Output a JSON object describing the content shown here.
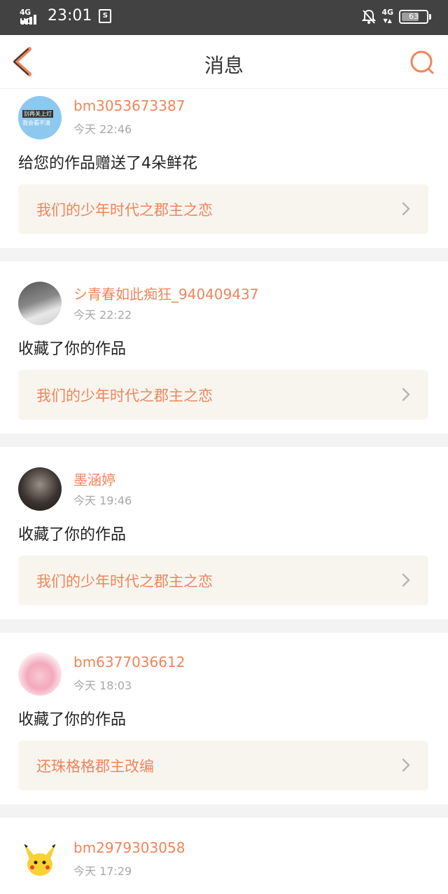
{
  "status_bar": {
    "network": "4G HD",
    "time": "23:01",
    "sim_icon": "sim-icon",
    "mobile_type": "4G",
    "battery": "63"
  },
  "header": {
    "title": "消息",
    "back_icon": "back-arrow-icon",
    "search_icon": "search-icon"
  },
  "messages": [
    {
      "username": "bm3053673387",
      "time": "今天 22:46",
      "action": "给您的作品赠送了4朵鲜花",
      "work_title": "我们的少年时代之郡主之恋",
      "avatar_line1": "别再关上灯",
      "avatar_line2": "我会看不清"
    },
    {
      "username": "シ青春如此痴狂_940409437",
      "time": "今天 22:22",
      "action": "收藏了你的作品",
      "work_title": "我们的少年时代之郡主之恋"
    },
    {
      "username": "墨涵婷",
      "time": "今天 19:46",
      "action": "收藏了你的作品",
      "work_title": "我们的少年时代之郡主之恋"
    },
    {
      "username": "bm6377036612",
      "time": "今天 18:03",
      "action": "收藏了你的作品",
      "work_title": "还珠格格郡主改编"
    },
    {
      "username": "bm2979303058",
      "time": "今天 17:29"
    }
  ],
  "colors": {
    "accent": "#f0855a",
    "status_bar": "#424242",
    "card_bg": "#f8f5ef",
    "divider": "#f3f3f3"
  }
}
